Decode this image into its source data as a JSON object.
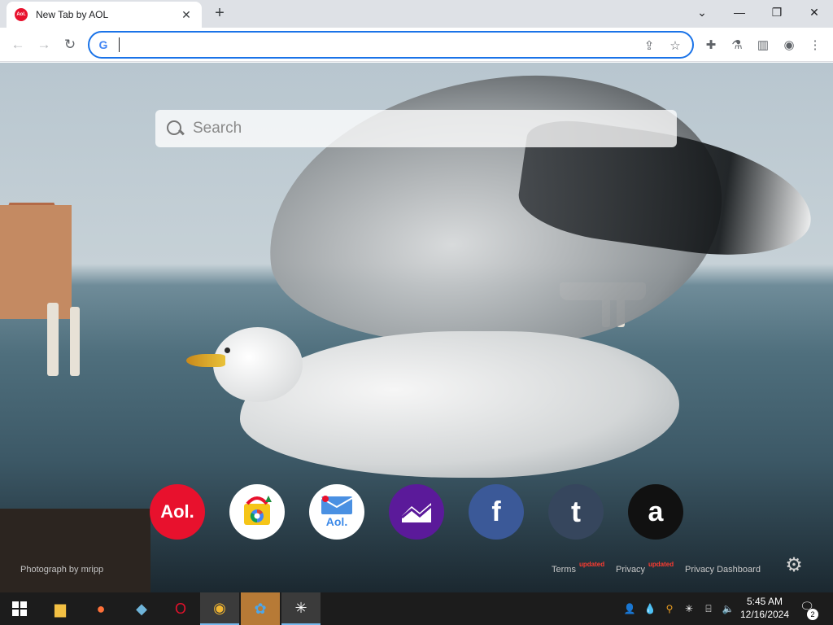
{
  "browser": {
    "tab_title": "New Tab by AOL",
    "tab_favicon_text": "Aol.",
    "new_tab_symbol": "+",
    "omnibox_value": "",
    "colors": {
      "accent": "#1a73e8",
      "aol_red": "#e8112d"
    }
  },
  "page": {
    "search_placeholder": "Search",
    "photo_credit": "Photograph by mripp",
    "footer": {
      "terms": "Terms",
      "terms_badge": "updated",
      "privacy": "Privacy",
      "privacy_badge": "updated",
      "privacy_dashboard": "Privacy Dashboard"
    },
    "shortcuts": [
      {
        "name": "aol",
        "label": "Aol."
      },
      {
        "name": "chrome-store",
        "label": ""
      },
      {
        "name": "aol-mail",
        "label": "Aol."
      },
      {
        "name": "finance",
        "label": ""
      },
      {
        "name": "facebook",
        "label": "f"
      },
      {
        "name": "tumblr",
        "label": "t"
      },
      {
        "name": "amazon",
        "label": "a"
      }
    ]
  },
  "taskbar": {
    "time": "5:45 AM",
    "date": "12/16/2024",
    "notification_count": "2"
  }
}
